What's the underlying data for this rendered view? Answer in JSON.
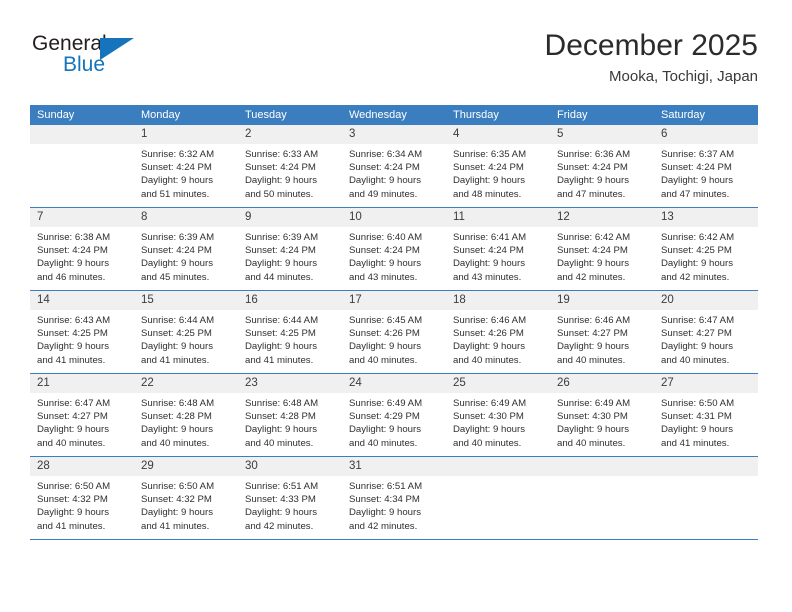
{
  "brand": {
    "name_part1": "General",
    "name_part2": "Blue",
    "triangle_color": "#1574bb"
  },
  "header": {
    "month_title": "December 2025",
    "location": "Mooka, Tochigi, Japan"
  },
  "theme": {
    "header_blue": "#3a7ebf",
    "daynum_band": "#f0f0f0",
    "text": "#2f2f2f"
  },
  "weekday_headers": [
    "Sunday",
    "Monday",
    "Tuesday",
    "Wednesday",
    "Thursday",
    "Friday",
    "Saturday"
  ],
  "weeks": [
    [
      {
        "day": "",
        "empty": true,
        "sunrise": "",
        "sunset": "",
        "daylight_line1": "",
        "daylight_line2": ""
      },
      {
        "day": "1",
        "sunrise": "Sunrise: 6:32 AM",
        "sunset": "Sunset: 4:24 PM",
        "daylight_line1": "Daylight: 9 hours",
        "daylight_line2": "and 51 minutes."
      },
      {
        "day": "2",
        "sunrise": "Sunrise: 6:33 AM",
        "sunset": "Sunset: 4:24 PM",
        "daylight_line1": "Daylight: 9 hours",
        "daylight_line2": "and 50 minutes."
      },
      {
        "day": "3",
        "sunrise": "Sunrise: 6:34 AM",
        "sunset": "Sunset: 4:24 PM",
        "daylight_line1": "Daylight: 9 hours",
        "daylight_line2": "and 49 minutes."
      },
      {
        "day": "4",
        "sunrise": "Sunrise: 6:35 AM",
        "sunset": "Sunset: 4:24 PM",
        "daylight_line1": "Daylight: 9 hours",
        "daylight_line2": "and 48 minutes."
      },
      {
        "day": "5",
        "sunrise": "Sunrise: 6:36 AM",
        "sunset": "Sunset: 4:24 PM",
        "daylight_line1": "Daylight: 9 hours",
        "daylight_line2": "and 47 minutes."
      },
      {
        "day": "6",
        "sunrise": "Sunrise: 6:37 AM",
        "sunset": "Sunset: 4:24 PM",
        "daylight_line1": "Daylight: 9 hours",
        "daylight_line2": "and 47 minutes."
      }
    ],
    [
      {
        "day": "7",
        "sunrise": "Sunrise: 6:38 AM",
        "sunset": "Sunset: 4:24 PM",
        "daylight_line1": "Daylight: 9 hours",
        "daylight_line2": "and 46 minutes."
      },
      {
        "day": "8",
        "sunrise": "Sunrise: 6:39 AM",
        "sunset": "Sunset: 4:24 PM",
        "daylight_line1": "Daylight: 9 hours",
        "daylight_line2": "and 45 minutes."
      },
      {
        "day": "9",
        "sunrise": "Sunrise: 6:39 AM",
        "sunset": "Sunset: 4:24 PM",
        "daylight_line1": "Daylight: 9 hours",
        "daylight_line2": "and 44 minutes."
      },
      {
        "day": "10",
        "sunrise": "Sunrise: 6:40 AM",
        "sunset": "Sunset: 4:24 PM",
        "daylight_line1": "Daylight: 9 hours",
        "daylight_line2": "and 43 minutes."
      },
      {
        "day": "11",
        "sunrise": "Sunrise: 6:41 AM",
        "sunset": "Sunset: 4:24 PM",
        "daylight_line1": "Daylight: 9 hours",
        "daylight_line2": "and 43 minutes."
      },
      {
        "day": "12",
        "sunrise": "Sunrise: 6:42 AM",
        "sunset": "Sunset: 4:24 PM",
        "daylight_line1": "Daylight: 9 hours",
        "daylight_line2": "and 42 minutes."
      },
      {
        "day": "13",
        "sunrise": "Sunrise: 6:42 AM",
        "sunset": "Sunset: 4:25 PM",
        "daylight_line1": "Daylight: 9 hours",
        "daylight_line2": "and 42 minutes."
      }
    ],
    [
      {
        "day": "14",
        "sunrise": "Sunrise: 6:43 AM",
        "sunset": "Sunset: 4:25 PM",
        "daylight_line1": "Daylight: 9 hours",
        "daylight_line2": "and 41 minutes."
      },
      {
        "day": "15",
        "sunrise": "Sunrise: 6:44 AM",
        "sunset": "Sunset: 4:25 PM",
        "daylight_line1": "Daylight: 9 hours",
        "daylight_line2": "and 41 minutes."
      },
      {
        "day": "16",
        "sunrise": "Sunrise: 6:44 AM",
        "sunset": "Sunset: 4:25 PM",
        "daylight_line1": "Daylight: 9 hours",
        "daylight_line2": "and 41 minutes."
      },
      {
        "day": "17",
        "sunrise": "Sunrise: 6:45 AM",
        "sunset": "Sunset: 4:26 PM",
        "daylight_line1": "Daylight: 9 hours",
        "daylight_line2": "and 40 minutes."
      },
      {
        "day": "18",
        "sunrise": "Sunrise: 6:46 AM",
        "sunset": "Sunset: 4:26 PM",
        "daylight_line1": "Daylight: 9 hours",
        "daylight_line2": "and 40 minutes."
      },
      {
        "day": "19",
        "sunrise": "Sunrise: 6:46 AM",
        "sunset": "Sunset: 4:27 PM",
        "daylight_line1": "Daylight: 9 hours",
        "daylight_line2": "and 40 minutes."
      },
      {
        "day": "20",
        "sunrise": "Sunrise: 6:47 AM",
        "sunset": "Sunset: 4:27 PM",
        "daylight_line1": "Daylight: 9 hours",
        "daylight_line2": "and 40 minutes."
      }
    ],
    [
      {
        "day": "21",
        "sunrise": "Sunrise: 6:47 AM",
        "sunset": "Sunset: 4:27 PM",
        "daylight_line1": "Daylight: 9 hours",
        "daylight_line2": "and 40 minutes."
      },
      {
        "day": "22",
        "sunrise": "Sunrise: 6:48 AM",
        "sunset": "Sunset: 4:28 PM",
        "daylight_line1": "Daylight: 9 hours",
        "daylight_line2": "and 40 minutes."
      },
      {
        "day": "23",
        "sunrise": "Sunrise: 6:48 AM",
        "sunset": "Sunset: 4:28 PM",
        "daylight_line1": "Daylight: 9 hours",
        "daylight_line2": "and 40 minutes."
      },
      {
        "day": "24",
        "sunrise": "Sunrise: 6:49 AM",
        "sunset": "Sunset: 4:29 PM",
        "daylight_line1": "Daylight: 9 hours",
        "daylight_line2": "and 40 minutes."
      },
      {
        "day": "25",
        "sunrise": "Sunrise: 6:49 AM",
        "sunset": "Sunset: 4:30 PM",
        "daylight_line1": "Daylight: 9 hours",
        "daylight_line2": "and 40 minutes."
      },
      {
        "day": "26",
        "sunrise": "Sunrise: 6:49 AM",
        "sunset": "Sunset: 4:30 PM",
        "daylight_line1": "Daylight: 9 hours",
        "daylight_line2": "and 40 minutes."
      },
      {
        "day": "27",
        "sunrise": "Sunrise: 6:50 AM",
        "sunset": "Sunset: 4:31 PM",
        "daylight_line1": "Daylight: 9 hours",
        "daylight_line2": "and 41 minutes."
      }
    ],
    [
      {
        "day": "28",
        "sunrise": "Sunrise: 6:50 AM",
        "sunset": "Sunset: 4:32 PM",
        "daylight_line1": "Daylight: 9 hours",
        "daylight_line2": "and 41 minutes."
      },
      {
        "day": "29",
        "sunrise": "Sunrise: 6:50 AM",
        "sunset": "Sunset: 4:32 PM",
        "daylight_line1": "Daylight: 9 hours",
        "daylight_line2": "and 41 minutes."
      },
      {
        "day": "30",
        "sunrise": "Sunrise: 6:51 AM",
        "sunset": "Sunset: 4:33 PM",
        "daylight_line1": "Daylight: 9 hours",
        "daylight_line2": "and 42 minutes."
      },
      {
        "day": "31",
        "sunrise": "Sunrise: 6:51 AM",
        "sunset": "Sunset: 4:34 PM",
        "daylight_line1": "Daylight: 9 hours",
        "daylight_line2": "and 42 minutes."
      },
      {
        "day": "",
        "empty": true,
        "sunrise": "",
        "sunset": "",
        "daylight_line1": "",
        "daylight_line2": ""
      },
      {
        "day": "",
        "empty": true,
        "sunrise": "",
        "sunset": "",
        "daylight_line1": "",
        "daylight_line2": ""
      },
      {
        "day": "",
        "empty": true,
        "sunrise": "",
        "sunset": "",
        "daylight_line1": "",
        "daylight_line2": ""
      }
    ]
  ]
}
